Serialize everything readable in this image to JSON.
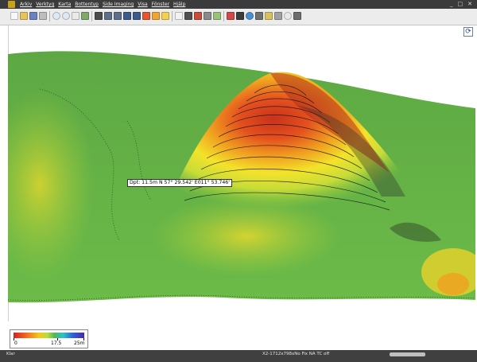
{
  "menu": {
    "items": [
      "Arkiv",
      "Verktyg",
      "Karta",
      "Bottentyp",
      "Side Imaging",
      "Visa",
      "Fönster",
      "Hjälp"
    ]
  },
  "window": {
    "minimize": "_",
    "maximize": "□",
    "close": "✕"
  },
  "toolbar": {
    "icons": [
      "new-icon",
      "open-icon",
      "save-icon",
      "print-icon",
      "zoom-in-icon",
      "zoom-out-icon",
      "zoom-fit-icon",
      "chart-icon",
      "layers-icon",
      "back-icon",
      "forward-icon",
      "depth-up-icon",
      "depth-down-icon",
      "palette-icon",
      "compass-icon",
      "color-map-icon",
      "doc-icon",
      "camera-icon",
      "waypoint-icon",
      "settings-icon",
      "map-icon",
      "flag-icon",
      "grid-icon",
      "globe-icon",
      "list-icon",
      "track-icon",
      "contour-icon",
      "search-icon",
      "edit-icon"
    ]
  },
  "view": {
    "reset_icon": "refresh-icon",
    "reset_glyph": "⟳",
    "cursor_label": "Dpt: 11.5m N 57° 29.542' E011° 53.746'"
  },
  "legend": {
    "min": "0",
    "mid": "17.5",
    "max": "25m"
  },
  "status": {
    "left": "Klar",
    "right": "X2-1712x798xNo Fix   NA  TC off"
  },
  "colors": {
    "deep_green": "#4f9e3a",
    "green": "#6cbf45",
    "yellow": "#f2e22a",
    "orange": "#f08a1e",
    "red": "#d6311c"
  }
}
